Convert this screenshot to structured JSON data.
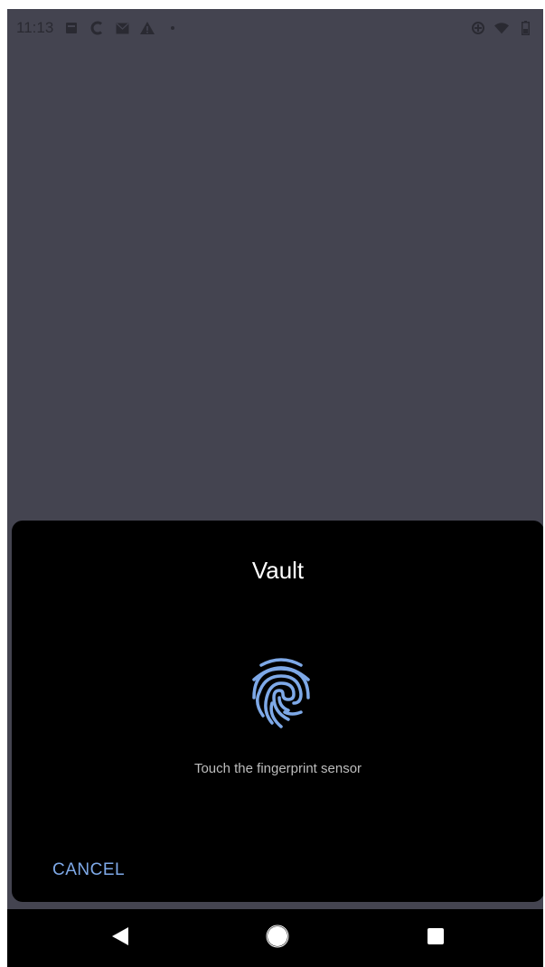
{
  "status_bar": {
    "time": "11:13",
    "left_icons": [
      "image-icon",
      "c-app-icon",
      "mail-icon",
      "warning-icon",
      "dot-icon"
    ],
    "right_icons": [
      "data-saver-icon",
      "wifi-icon",
      "battery-icon"
    ]
  },
  "dialog": {
    "title": "Vault",
    "icon": "fingerprint-icon",
    "hint": "Touch the fingerprint sensor",
    "cancel_label": "CANCEL"
  },
  "nav_bar": {
    "buttons": [
      "back-icon",
      "home-icon",
      "recents-icon"
    ]
  },
  "colors": {
    "screen_background": "#444450",
    "dialog_background": "#000000",
    "accent": "#7ea9e8",
    "fingerprint": "#7ea9e8"
  }
}
